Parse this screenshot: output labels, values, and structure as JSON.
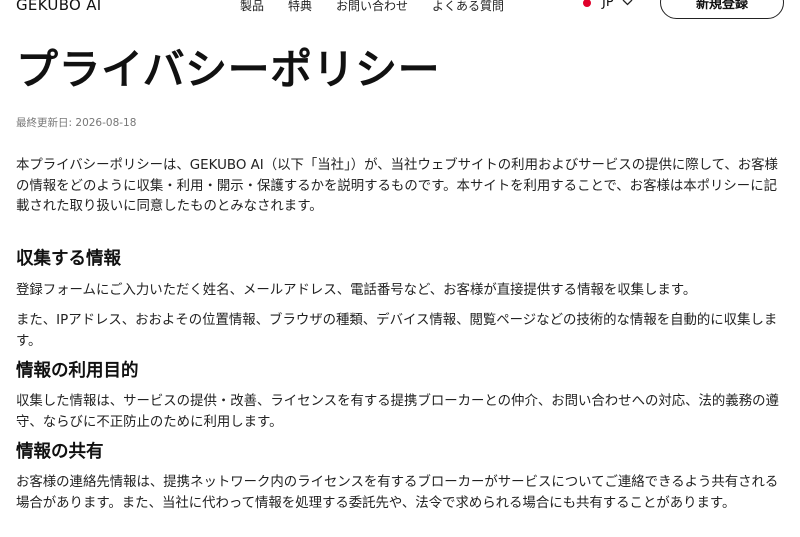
{
  "header": {
    "logo": "GEKUBO AI",
    "nav": [
      "製品",
      "特典",
      "お問い合わせ",
      "よくある質問"
    ],
    "language": "JP",
    "signup_label": "新規登録"
  },
  "page": {
    "title": "プライバシーポリシー",
    "last_updated_label": "最終更新日:",
    "last_updated_date": "2026-08-18",
    "intro": "本プライバシーポリシーは、GEKUBO AI（以下「当社」）が、当社ウェブサイトの利用およびサービスの提供に際して、お客様の情報をどのように収集・利用・開示・保護するかを説明するものです。本サイトを利用することで、お客様は本ポリシーに記載された取り扱いに同意したものとみなされます。",
    "sections": [
      {
        "heading": "収集する情報",
        "paragraphs": [
          "登録フォームにご入力いただく姓名、メールアドレス、電話番号など、お客様が直接提供する情報を収集します。",
          "また、IPアドレス、おおよその位置情報、ブラウザの種類、デバイス情報、閲覧ページなどの技術的な情報を自動的に収集します。"
        ]
      },
      {
        "heading": "情報の利用目的",
        "paragraphs": [
          "収集した情報は、サービスの提供・改善、ライセンスを有する提携ブローカーとの仲介、お問い合わせへの対応、法的義務の遵守、ならびに不正防止のために利用します。"
        ]
      },
      {
        "heading": "情報の共有",
        "paragraphs": [
          "お客様の連絡先情報は、提携ネットワーク内のライセンスを有するブローカーがサービスについてご連絡できるよう共有される場合があります。また、当社に代わって情報を処理する委託先や、法令で求められる場合にも共有することがあります。"
        ]
      }
    ]
  }
}
